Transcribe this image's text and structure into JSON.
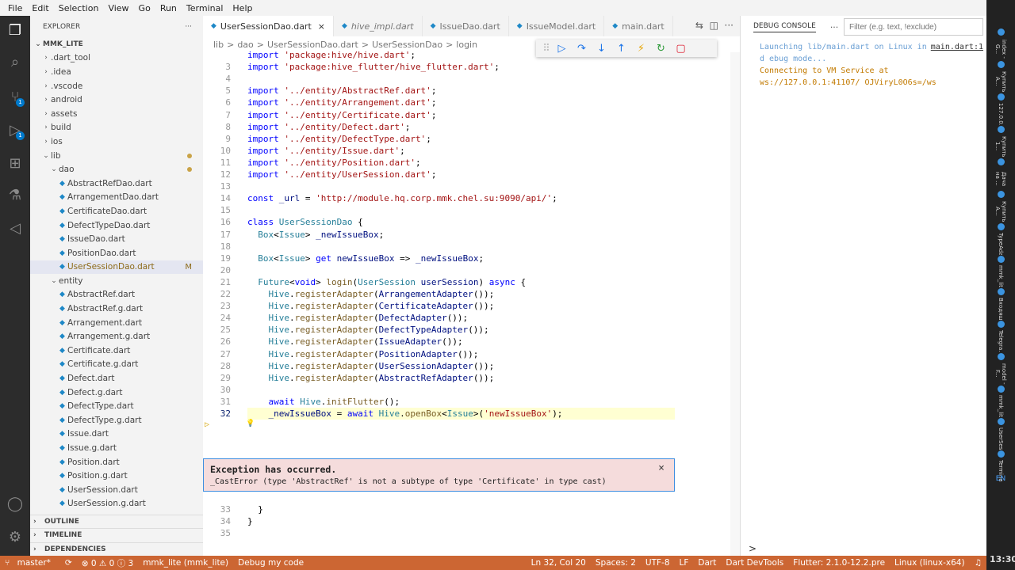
{
  "menu": [
    "File",
    "Edit",
    "Selection",
    "View",
    "Go",
    "Run",
    "Terminal",
    "Help"
  ],
  "explorer": {
    "title": "EXPLORER",
    "project": "MMK_LITE",
    "items": [
      {
        "label": ".dart_tool",
        "kind": "folder",
        "indent": 1,
        "open": false
      },
      {
        "label": ".idea",
        "kind": "folder",
        "indent": 1,
        "open": false
      },
      {
        "label": ".vscode",
        "kind": "folder",
        "indent": 1,
        "open": false
      },
      {
        "label": "android",
        "kind": "folder",
        "indent": 1,
        "open": false
      },
      {
        "label": "assets",
        "kind": "folder",
        "indent": 1,
        "open": false
      },
      {
        "label": "build",
        "kind": "folder",
        "indent": 1,
        "open": false
      },
      {
        "label": "ios",
        "kind": "folder",
        "indent": 1,
        "open": false
      },
      {
        "label": "lib",
        "kind": "folder",
        "indent": 1,
        "open": true,
        "dot": true
      },
      {
        "label": "dao",
        "kind": "folder",
        "indent": 2,
        "open": true,
        "dot": true
      },
      {
        "label": "AbstractRefDao.dart",
        "kind": "file",
        "indent": 3
      },
      {
        "label": "ArrangementDao.dart",
        "kind": "file",
        "indent": 3
      },
      {
        "label": "CertificateDao.dart",
        "kind": "file",
        "indent": 3
      },
      {
        "label": "DefectTypeDao.dart",
        "kind": "file",
        "indent": 3
      },
      {
        "label": "IssueDao.dart",
        "kind": "file",
        "indent": 3
      },
      {
        "label": "PositionDao.dart",
        "kind": "file",
        "indent": 3
      },
      {
        "label": "UserSessionDao.dart",
        "kind": "file",
        "indent": 3,
        "selected": true,
        "mark": "M"
      },
      {
        "label": "entity",
        "kind": "folder",
        "indent": 2,
        "open": true
      },
      {
        "label": "AbstractRef.dart",
        "kind": "file",
        "indent": 3
      },
      {
        "label": "AbstractRef.g.dart",
        "kind": "file",
        "indent": 3
      },
      {
        "label": "Arrangement.dart",
        "kind": "file",
        "indent": 3
      },
      {
        "label": "Arrangement.g.dart",
        "kind": "file",
        "indent": 3
      },
      {
        "label": "Certificate.dart",
        "kind": "file",
        "indent": 3
      },
      {
        "label": "Certificate.g.dart",
        "kind": "file",
        "indent": 3
      },
      {
        "label": "Defect.dart",
        "kind": "file",
        "indent": 3
      },
      {
        "label": "Defect.g.dart",
        "kind": "file",
        "indent": 3
      },
      {
        "label": "DefectType.dart",
        "kind": "file",
        "indent": 3
      },
      {
        "label": "DefectType.g.dart",
        "kind": "file",
        "indent": 3
      },
      {
        "label": "Issue.dart",
        "kind": "file",
        "indent": 3
      },
      {
        "label": "Issue.g.dart",
        "kind": "file",
        "indent": 3
      },
      {
        "label": "Position.dart",
        "kind": "file",
        "indent": 3
      },
      {
        "label": "Position.g.dart",
        "kind": "file",
        "indent": 3
      },
      {
        "label": "UserSession.dart",
        "kind": "file",
        "indent": 3
      },
      {
        "label": "UserSession.g.dart",
        "kind": "file",
        "indent": 3
      }
    ],
    "outline": "OUTLINE",
    "timeline": "TIMELINE",
    "dependencies": "DEPENDENCIES"
  },
  "tabs": [
    {
      "label": "UserSessionDao.dart",
      "active": true,
      "italic": false,
      "close": "×"
    },
    {
      "label": "hive_impl.dart",
      "active": false,
      "italic": true
    },
    {
      "label": "IssueDao.dart",
      "active": false,
      "italic": false
    },
    {
      "label": "IssueModel.dart",
      "active": false,
      "italic": false
    },
    {
      "label": "main.dart",
      "active": false,
      "italic": false
    }
  ],
  "breadcrumb": [
    "lib",
    ">",
    "dao",
    ">",
    "UserSessionDao.dart",
    ">",
    "UserSessionDao",
    ">",
    "login"
  ],
  "code": [
    {
      "n": "",
      "t": "import 'package:hive/hive.dart';"
    },
    {
      "n": "3",
      "t": "import 'package:hive_flutter/hive_flutter.dart';"
    },
    {
      "n": "4",
      "t": ""
    },
    {
      "n": "5",
      "t": "import '../entity/AbstractRef.dart';"
    },
    {
      "n": "6",
      "t": "import '../entity/Arrangement.dart';"
    },
    {
      "n": "7",
      "t": "import '../entity/Certificate.dart';"
    },
    {
      "n": "8",
      "t": "import '../entity/Defect.dart';"
    },
    {
      "n": "9",
      "t": "import '../entity/DefectType.dart';"
    },
    {
      "n": "10",
      "t": "import '../entity/Issue.dart';"
    },
    {
      "n": "11",
      "t": "import '../entity/Position.dart';"
    },
    {
      "n": "12",
      "t": "import '../entity/UserSession.dart';"
    },
    {
      "n": "13",
      "t": ""
    },
    {
      "n": "14",
      "t": "const _url = 'http://module.hq.corp.mmk.chel.su:9090/api/';"
    },
    {
      "n": "15",
      "t": ""
    },
    {
      "n": "16",
      "t": "class UserSessionDao {"
    },
    {
      "n": "17",
      "t": "  Box<Issue> _newIssueBox;"
    },
    {
      "n": "18",
      "t": ""
    },
    {
      "n": "19",
      "t": "  Box<Issue> get newIssueBox => _newIssueBox;"
    },
    {
      "n": "20",
      "t": ""
    },
    {
      "n": "21",
      "t": "  Future<void> login(UserSession userSession) async {"
    },
    {
      "n": "22",
      "t": "    Hive.registerAdapter(ArrangementAdapter());"
    },
    {
      "n": "23",
      "t": "    Hive.registerAdapter(CertificateAdapter());"
    },
    {
      "n": "24",
      "t": "    Hive.registerAdapter(DefectAdapter());"
    },
    {
      "n": "25",
      "t": "    Hive.registerAdapter(DefectTypeAdapter());"
    },
    {
      "n": "26",
      "t": "    Hive.registerAdapter(IssueAdapter());"
    },
    {
      "n": "27",
      "t": "    Hive.registerAdapter(PositionAdapter());"
    },
    {
      "n": "28",
      "t": "    Hive.registerAdapter(UserSessionAdapter());"
    },
    {
      "n": "29",
      "t": "    Hive.registerAdapter(AbstractRefAdapter());"
    },
    {
      "n": "30",
      "t": ""
    },
    {
      "n": "31",
      "t": "    await Hive.initFlutter();"
    },
    {
      "n": "32",
      "t": "    _newIssueBox = await Hive.openBox<Issue>('newIssueBox');",
      "current": true
    }
  ],
  "code_after": [
    {
      "n": "33",
      "t": "  }"
    },
    {
      "n": "34",
      "t": "}"
    },
    {
      "n": "35",
      "t": ""
    }
  ],
  "exception": {
    "title": "Exception has occurred.",
    "message": "_CastError (type 'AbstractRef' is not a subtype of type 'Certificate' in type cast)",
    "close": "×"
  },
  "debug_console": {
    "title": "DEBUG CONSOLE",
    "more": "···",
    "filter_placeholder": "Filter (e.g. text, !exclude)",
    "lines": [
      {
        "text": "Launching lib/main.dart on Linux in d ebug mode...",
        "link": "main.dart:1",
        "color": "#6a9fd4"
      },
      {
        "text": "Connecting to VM Service at ws://127.0.0.1:41107/ OJViryL0O6s=/ws",
        "color": "#c27a00"
      }
    ],
    "prompt": ">"
  },
  "statusbar": {
    "branch": "master*",
    "sync": "⟳",
    "problems": "⊗ 0 ⚠ 0 ⓘ 3",
    "project": "mmk_lite (mmk_lite)",
    "debug": "Debug my code",
    "position": "Ln 32, Col 20",
    "spaces": "Spaces: 2",
    "encoding": "UTF-8",
    "eol": "LF",
    "lang": "Dart",
    "devtools": "Dart DevTools",
    "flutter": "Flutter: 2.1.0-12.2.pre",
    "device": "Linux (linux-x64)"
  },
  "taskbar": {
    "items": [
      "index - G...",
      "Купить А...",
      "127.0.0.1...",
      "Купить 1...",
      "Дача на ...",
      "Купить А...",
      "TypeAda...",
      "mmk_lite",
      "Входящ...",
      "Telegra...",
      "model - F...",
      "mmk_lite...",
      "UserSes...",
      "Terminal..."
    ],
    "lang": "EN",
    "clock": "13:30"
  },
  "colors": {
    "status": "#cc6633",
    "accent": "#007acc",
    "exception_bg": "#f5dcdc"
  }
}
